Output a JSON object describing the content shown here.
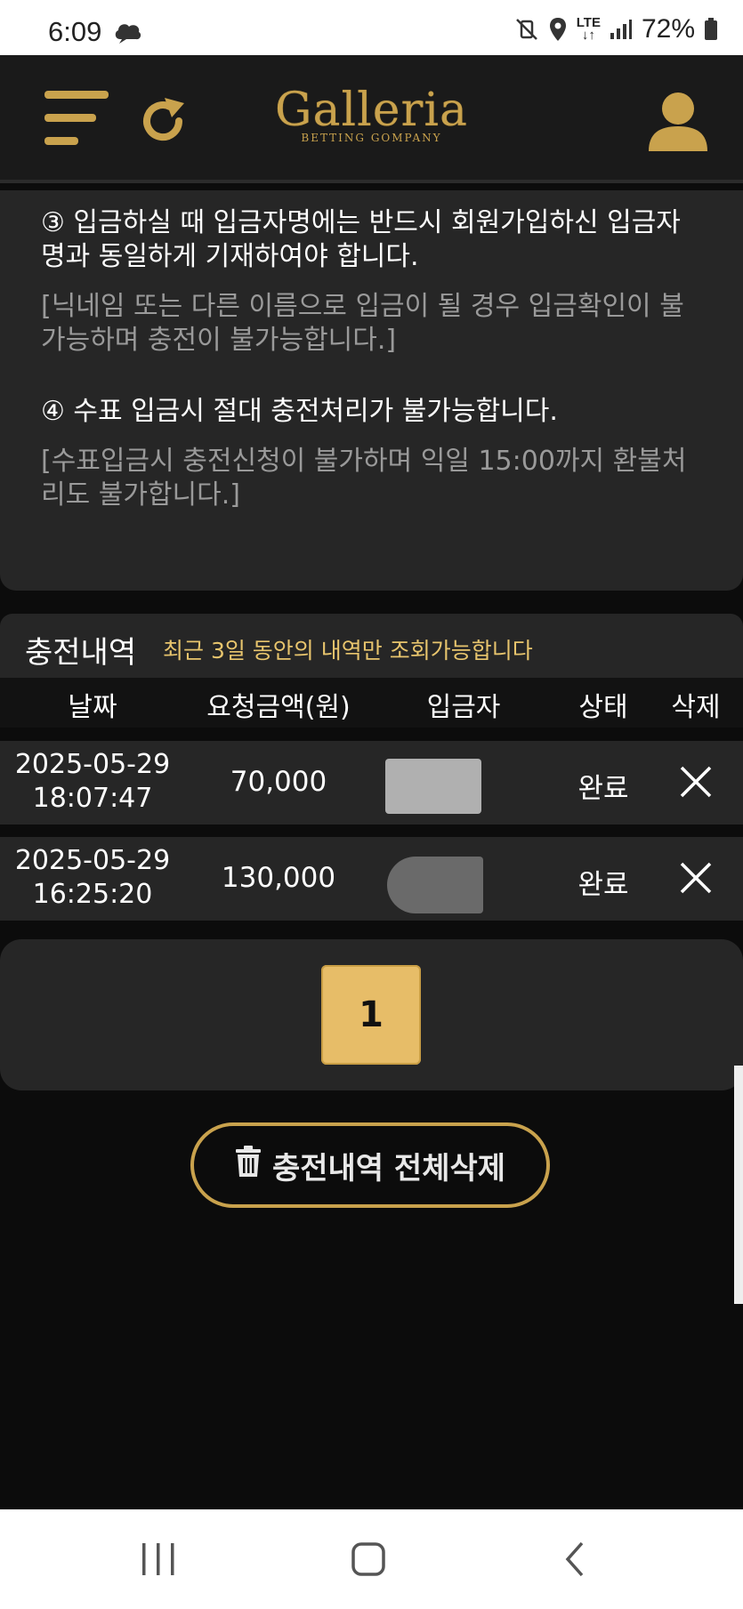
{
  "statusbar": {
    "time": "6:09",
    "battery": "72%",
    "network": "LTE"
  },
  "header": {
    "logo_main": "Galleria",
    "logo_sub": "BETTING GOMPANY"
  },
  "notice": {
    "item3_main": "③ 입금하실 때 입금자명에는 반드시 회원가입하신 입금자명과 동일하게 기재하여야 합니다.",
    "item3_sub": "[닉네임 또는 다른 이름으로 입금이 될 경우 입금확인이 불가능하며 충전이 불가능합니다.]",
    "item4_main": "④ 수표 입금시 절대 충전처리가 불가능합니다.",
    "item4_sub": "[수표입금시 충전신청이 불가하며 익일 15:00까지 환불처리도 불가합니다.]"
  },
  "history": {
    "title": "충전내역",
    "note": "최근 3일 동안의 내역만 조회가능합니다",
    "columns": [
      "날짜",
      "요청금액(원)",
      "입금자",
      "상태",
      "삭제"
    ],
    "rows": [
      {
        "date": "2025-05-29",
        "time": "18:07:47",
        "amount": "70,000",
        "status": "완료"
      },
      {
        "date": "2025-05-29",
        "time": "16:25:20",
        "amount": "130,000",
        "status": "완료"
      }
    ]
  },
  "pagination": {
    "current_page": "1"
  },
  "delete_all_label": "충전내역 전체삭제",
  "colors": {
    "gold": "#c9a24d",
    "page_button": "#e7bd68",
    "note_yellow": "#e8c56d",
    "panel": "#262626"
  }
}
